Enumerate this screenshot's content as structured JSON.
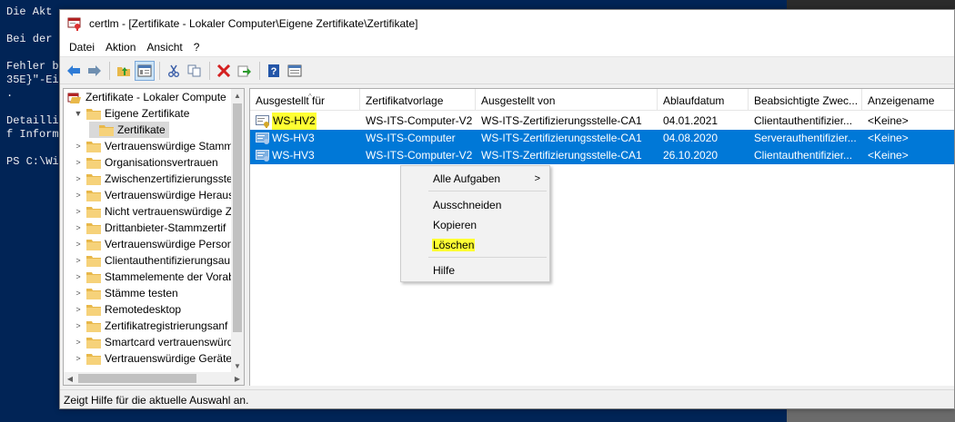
{
  "powershell": {
    "lines": [
      "Die Akt",
      "",
      "Bei der",
      "",
      "Fehler b",
      "35E}\"-Ei",
      ".",
      "",
      "Detailli",
      "f Inform",
      "",
      "PS C:\\Wi"
    ]
  },
  "window": {
    "title": "certlm - [Zertifikate - Lokaler Computer\\Eigene Zertifikate\\Zertifikate]"
  },
  "menu": [
    "Datei",
    "Aktion",
    "Ansicht",
    "?"
  ],
  "toolbar": {
    "icons": [
      "back-icon",
      "forward-icon",
      "up-folder-icon",
      "show-tree-icon",
      "cut-icon",
      "copy-icon",
      "delete-icon",
      "export-icon",
      "help-icon",
      "properties-icon"
    ]
  },
  "tree": {
    "items": [
      {
        "label": "Zertifikate - Lokaler Compute",
        "level": 0,
        "twisty": ""
      },
      {
        "label": "Eigene Zertifikate",
        "level": 1,
        "twisty": "▼"
      },
      {
        "label": "Zertifikate",
        "level": 2,
        "twisty": ""
      },
      {
        "label": "Vertrauenswürdige Stamm",
        "level": 1,
        "twisty": ">"
      },
      {
        "label": "Organisationsvertrauen",
        "level": 1,
        "twisty": ">"
      },
      {
        "label": "Zwischenzertifizierungsste",
        "level": 1,
        "twisty": ">"
      },
      {
        "label": "Vertrauenswürdige Heraus",
        "level": 1,
        "twisty": ">"
      },
      {
        "label": "Nicht vertrauenswürdige Z",
        "level": 1,
        "twisty": ">"
      },
      {
        "label": "Drittanbieter-Stammzertif",
        "level": 1,
        "twisty": ">"
      },
      {
        "label": "Vertrauenswürdige Person",
        "level": 1,
        "twisty": ">"
      },
      {
        "label": "Clientauthentifizierungsau",
        "level": 1,
        "twisty": ">"
      },
      {
        "label": "Stammelemente der Vorab",
        "level": 1,
        "twisty": ">"
      },
      {
        "label": "Stämme testen",
        "level": 1,
        "twisty": ">"
      },
      {
        "label": "Remotedesktop",
        "level": 1,
        "twisty": ">"
      },
      {
        "label": "Zertifikatregistrierungsanf",
        "level": 1,
        "twisty": ">"
      },
      {
        "label": "Smartcard vertrauenswürd",
        "level": 1,
        "twisty": ">"
      },
      {
        "label": "Vertrauenswürdige Geräte",
        "level": 1,
        "twisty": ">"
      }
    ]
  },
  "list": {
    "columns": [
      "Ausgestellt für",
      "Zertifikatvorlage",
      "Ausgestellt von",
      "Ablaufdatum",
      "Beabsichtigte Zwec...",
      "Anzeigename"
    ],
    "rows": [
      {
        "issued_to": "WS-HV2",
        "template": "WS-ITS-Computer-V2",
        "issuer": "WS-ITS-Zertifizierungsstelle-CA1",
        "expires": "04.01.2021",
        "purpose": "Clientauthentifizier...",
        "friendly": "<Keine>",
        "selected": false,
        "highlight": true
      },
      {
        "issued_to": "WS-HV3",
        "template": "WS-ITS-Computer",
        "issuer": "WS-ITS-Zertifizierungsstelle-CA1",
        "expires": "04.08.2020",
        "purpose": "Serverauthentifizier...",
        "friendly": "<Keine>",
        "selected": true,
        "highlight": false
      },
      {
        "issued_to": "WS-HV3",
        "template": "WS-ITS-Computer-V2",
        "issuer": "WS-ITS-Zertifizierungsstelle-CA1",
        "expires": "26.10.2020",
        "purpose": "Clientauthentifizier...",
        "friendly": "<Keine>",
        "selected": true,
        "highlight": false
      }
    ]
  },
  "context_menu": {
    "all_tasks": "Alle Aufgaben",
    "submenu_arrow": ">",
    "cut": "Ausschneiden",
    "copy": "Kopieren",
    "delete": "Löschen",
    "help": "Hilfe"
  },
  "status": "Zeigt Hilfe für die aktuelle Auswahl an.",
  "colors": {
    "selection": "#0078d7",
    "highlight": "#ffff33",
    "powershell_bg": "#012456"
  }
}
